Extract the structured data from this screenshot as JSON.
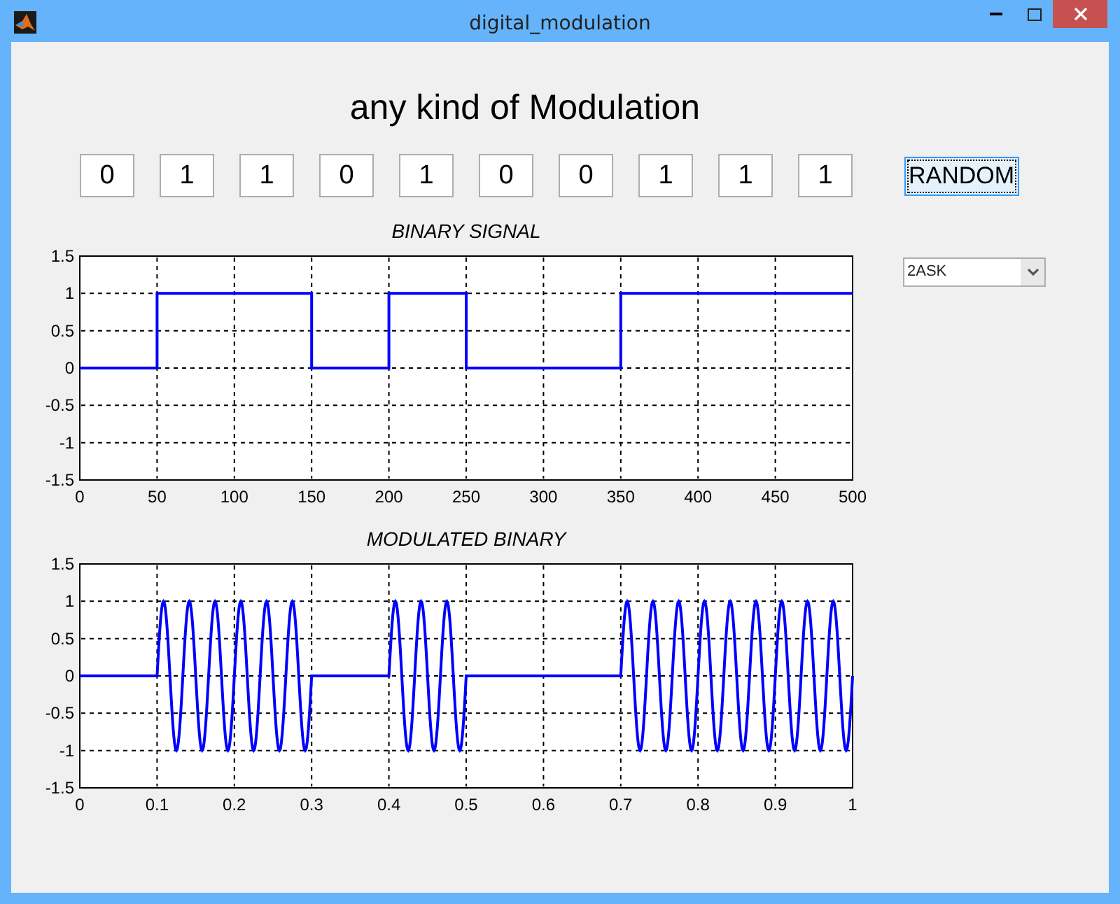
{
  "window": {
    "title": "digital_modulation"
  },
  "heading": "any kind of Modulation",
  "bits": [
    {
      "value": "0"
    },
    {
      "value": "1"
    },
    {
      "value": "1"
    },
    {
      "value": "0"
    },
    {
      "value": "1"
    },
    {
      "value": "0"
    },
    {
      "value": "0"
    },
    {
      "value": "1"
    },
    {
      "value": "1"
    },
    {
      "value": "1"
    }
  ],
  "random_button": {
    "label": "RANDOM",
    "focused": true
  },
  "modulation_select": {
    "value": "2ASK"
  },
  "binary_chart": {
    "chart_data": {
      "type": "line",
      "title": "BINARY SIGNAL",
      "grid": true,
      "xlim": [
        0,
        500
      ],
      "ylim": [
        -1.5,
        1.5
      ],
      "xticks": [
        0,
        50,
        100,
        150,
        200,
        250,
        300,
        350,
        400,
        450,
        500
      ],
      "yticks": [
        -1.5,
        -1,
        -0.5,
        0,
        0.5,
        1,
        1.5
      ],
      "series": [
        {
          "color": "#0000ff",
          "x": [
            0,
            50,
            50,
            150,
            150,
            200,
            200,
            250,
            250,
            350,
            350,
            500
          ],
          "values": [
            0,
            0,
            1,
            1,
            0,
            0,
            1,
            1,
            0,
            0,
            1,
            1
          ]
        }
      ]
    }
  },
  "modulated_plot": {
    "title": "MODULATED BINARY",
    "grid": true,
    "xtick_labels": [
      "0",
      "0.1",
      "0.2",
      "0.3",
      "0.4",
      "0.5",
      "0.6",
      "0.7",
      "0.8",
      "0.9",
      "1"
    ],
    "ytick_labels": [
      "1.5",
      "1",
      "0.5",
      "0",
      "-0.5",
      "-1",
      "-1.5"
    ]
  }
}
